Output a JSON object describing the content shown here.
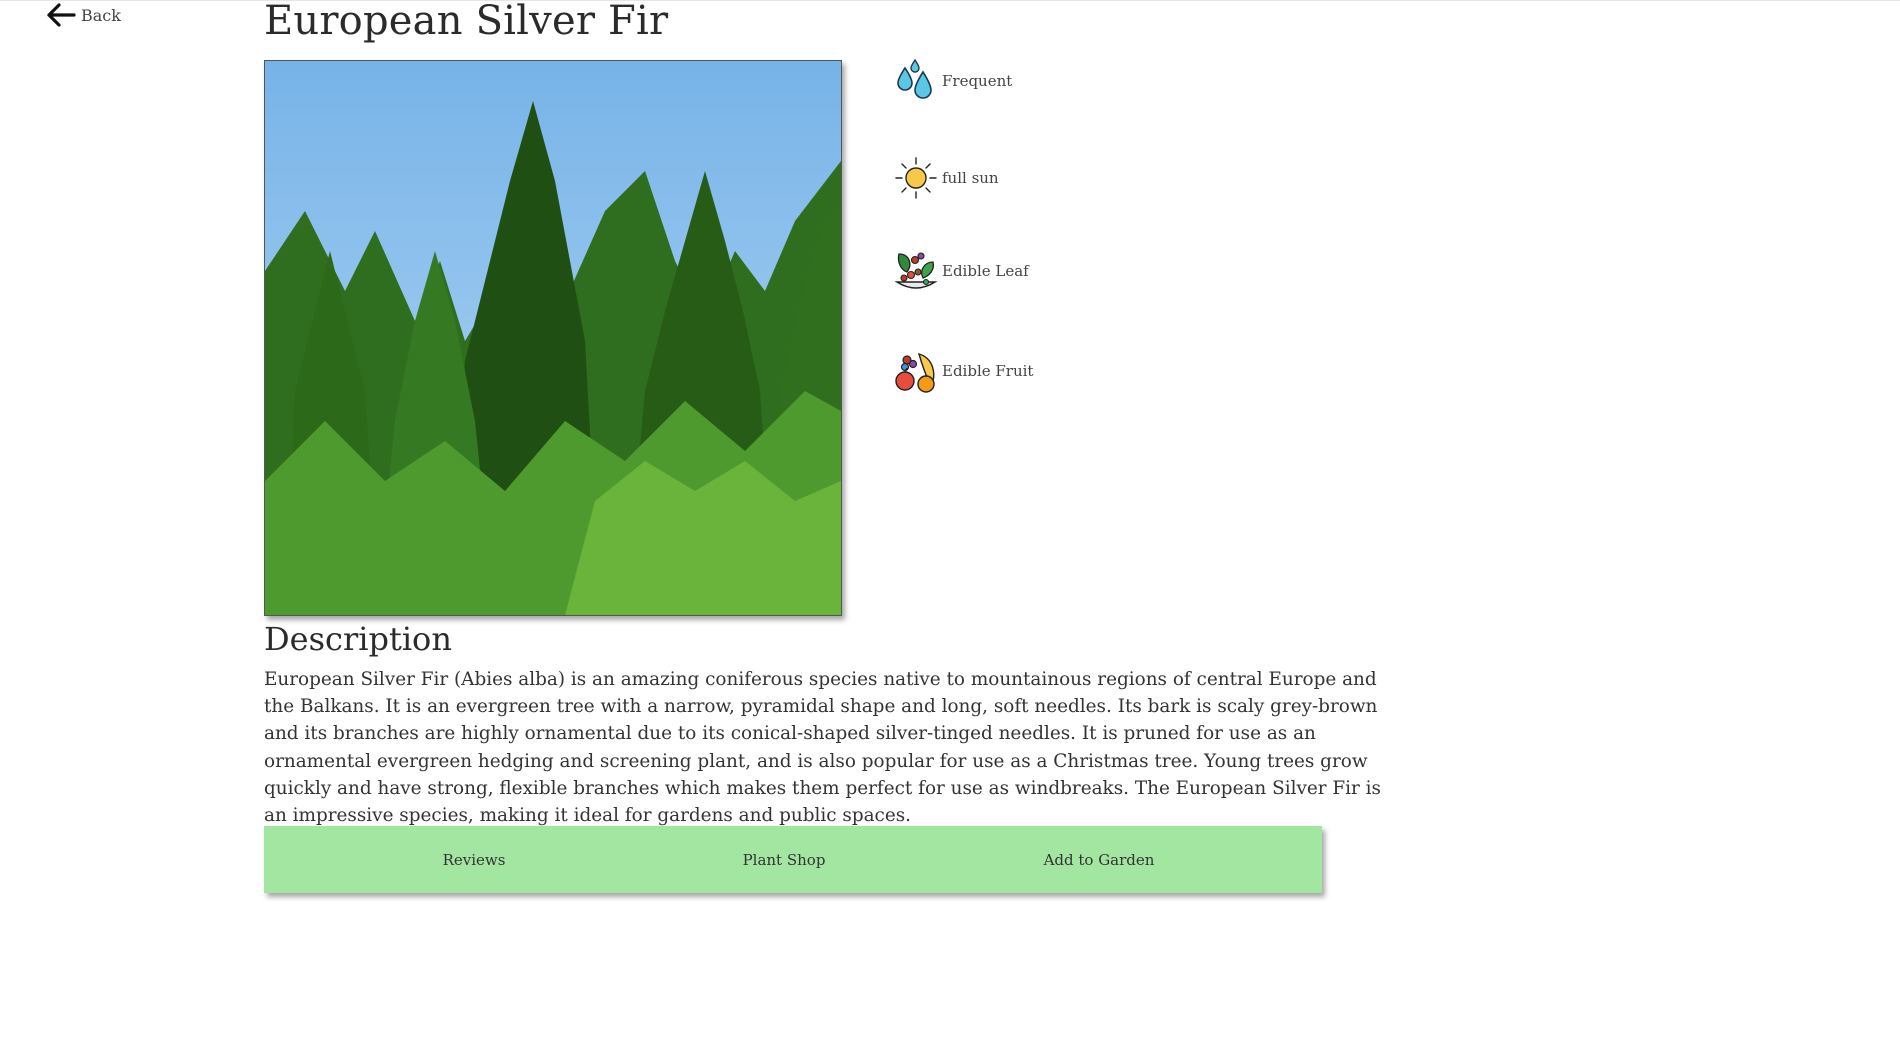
{
  "nav": {
    "back_label": "Back",
    "back_icon": "arrow-left-icon"
  },
  "plant": {
    "name": "European Silver Fir",
    "image_alt": "European Silver Fir trees"
  },
  "attributes": [
    {
      "icon": "water-drops-icon",
      "label": "Frequent"
    },
    {
      "icon": "sun-icon",
      "label": "full sun"
    },
    {
      "icon": "edible-leaf-icon",
      "label": "Edible Leaf"
    },
    {
      "icon": "edible-fruit-icon",
      "label": "Edible Fruit"
    }
  ],
  "description": {
    "heading": "Description",
    "text": "European Silver Fir (Abies alba) is an amazing coniferous species native to mountainous regions of central Europe and the Balkans. It is an evergreen tree with a narrow, pyramidal shape and long, soft needles. Its bark is scaly grey-brown and its branches are highly ornamental due to its conical-shaped silver-tinged needles. It is pruned for use as an ornamental evergreen hedging and screening plant, and is also popular for use as a Christmas tree. Young trees grow quickly and have strong, flexible branches which makes them perfect for use as windbreaks. The European Silver Fir is an impressive species, making it ideal for gardens and public spaces."
  },
  "actions": {
    "reviews_label": "Reviews",
    "shop_label": "Plant Shop",
    "garden_label": "Add to Garden"
  },
  "colors": {
    "action_bar": "#a3e6a1",
    "sky": "#7fb6e8",
    "water": "#5bc7e6",
    "sun": "#f7c948"
  }
}
